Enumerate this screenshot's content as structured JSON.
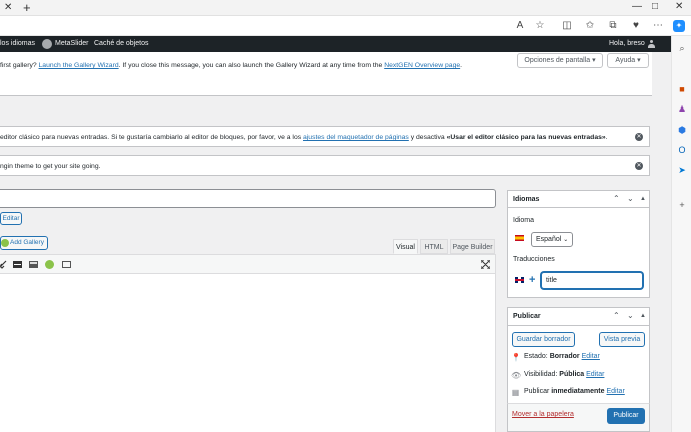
{
  "browser": {
    "tab_close": "✕",
    "new_tab": "+",
    "window_controls": [
      "—",
      "□",
      "✕"
    ],
    "toolbar_icons": [
      "read-aloud-icon",
      "favorite-star-icon",
      "split-screen-icon",
      "favorites-icon",
      "collections-icon",
      "extensions-icon",
      "more-icon"
    ]
  },
  "adminbar": {
    "items": [
      "los idiomas",
      "MetaSlider",
      "Caché de objetos"
    ],
    "greeting": "Hola, breso"
  },
  "screen_options": {
    "label": "Opciones de pantalla ▾",
    "help": "Ayuda ▾"
  },
  "notices": {
    "gallery": {
      "prefix": "first gallery? ",
      "link1": "Launch the Gallery Wizard",
      "middle": ". If you close this message, you can also launch the Gallery Wizard at any time from the ",
      "link2": "NextGEN Overview page",
      "suffix": "."
    },
    "classic": {
      "prefix": "editor clásico para nuevas entradas. Si te gustaría cambiarlo al editor de bloques, por favor, ve a los ",
      "link": "ajustes del maquetador de páginas",
      "middle": " y desactiva ",
      "strong": "«Usar el editor clásico para las nuevas entradas»",
      "suffix": "."
    },
    "theme": {
      "text": "ngin theme to get your site going."
    }
  },
  "editor": {
    "edit_slug_button": "Editar",
    "add_gallery_button": "Add Gallery",
    "tabs": [
      "Visual",
      "HTML",
      "Page Builder"
    ]
  },
  "idiomas_box": {
    "title": "Idiomas",
    "language_label": "Idioma",
    "selected_language": "Español",
    "translations_label": "Traducciones",
    "translation_value": "title"
  },
  "publish_box": {
    "title": "Publicar",
    "save_draft": "Guardar borrador",
    "preview": "Vista previa",
    "status_label": "Estado: ",
    "status_value": "Borrador",
    "visibility_label": "Visibilidad: ",
    "visibility_value": "Pública",
    "publish_label": "Publicar ",
    "publish_value": "inmediatamente",
    "edit": "Editar",
    "trash": "Mover a la papelera",
    "publish": "Publicar"
  },
  "colors": {
    "accent": "#2271b1",
    "adminbar": "#1d2327",
    "background": "#f0f0f1",
    "trash": "#b32d2e"
  }
}
